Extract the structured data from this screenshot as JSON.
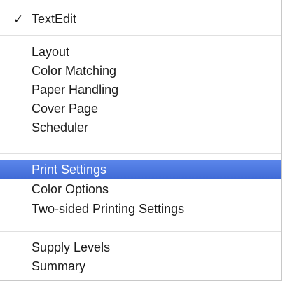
{
  "menu": {
    "app_item": {
      "check": "✓",
      "label": "TextEdit"
    },
    "group1": [
      "Layout",
      "Color Matching",
      "Paper Handling",
      "Cover Page",
      "Scheduler"
    ],
    "group2": [
      "Print Settings",
      "Color Options",
      "Two-sided Printing Settings"
    ],
    "group3": [
      "Supply Levels",
      "Summary"
    ],
    "selected_label": "Print Settings",
    "highlight_color": "#4b79e0"
  }
}
